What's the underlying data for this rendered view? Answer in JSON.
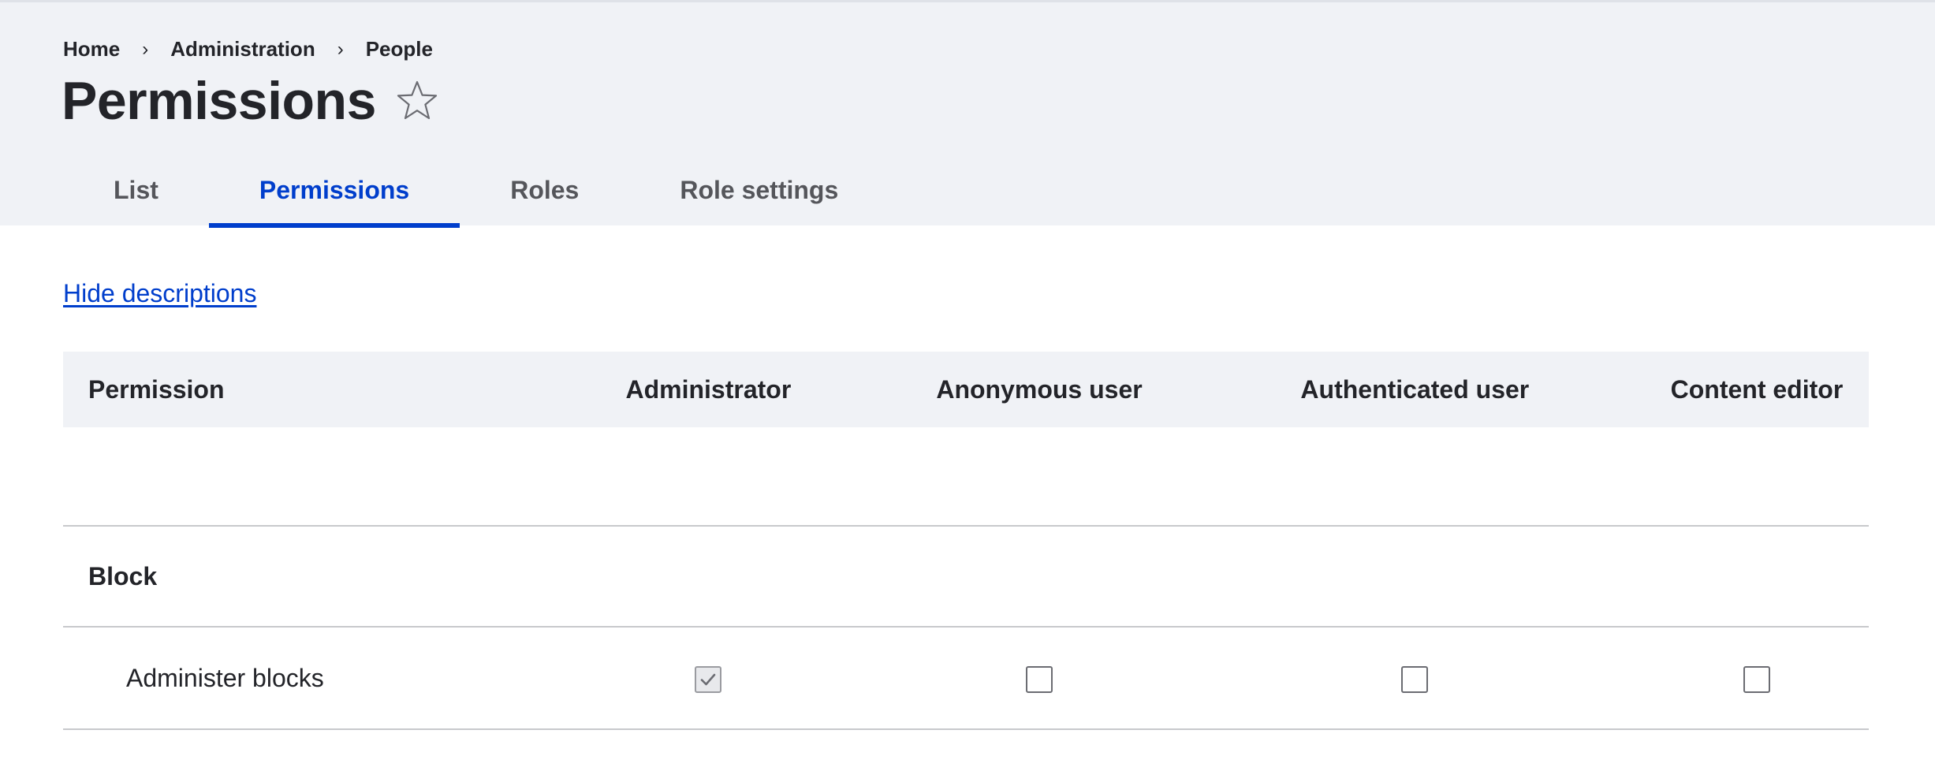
{
  "breadcrumb": {
    "items": [
      "Home",
      "Administration",
      "People"
    ],
    "separator": "›"
  },
  "page": {
    "title": "Permissions",
    "favorite_icon": "star-outline-icon"
  },
  "tabs": [
    {
      "label": "List",
      "active": false
    },
    {
      "label": "Permissions",
      "active": true
    },
    {
      "label": "Roles",
      "active": false
    },
    {
      "label": "Role settings",
      "active": false
    }
  ],
  "actions": {
    "hide_descriptions": "Hide descriptions"
  },
  "table": {
    "headers": [
      "Permission",
      "Administrator",
      "Anonymous user",
      "Authenticated user",
      "Content editor"
    ],
    "modules": [
      {
        "name": "Block",
        "permissions": [
          {
            "name": "Administer blocks",
            "roles": {
              "administrator": true,
              "anonymous": false,
              "authenticated": false,
              "content_editor": false
            }
          }
        ]
      }
    ]
  },
  "colors": {
    "accent": "#003ecc",
    "header_bg": "#f0f2f6",
    "text": "#232429",
    "border": "#c8c9cc"
  }
}
